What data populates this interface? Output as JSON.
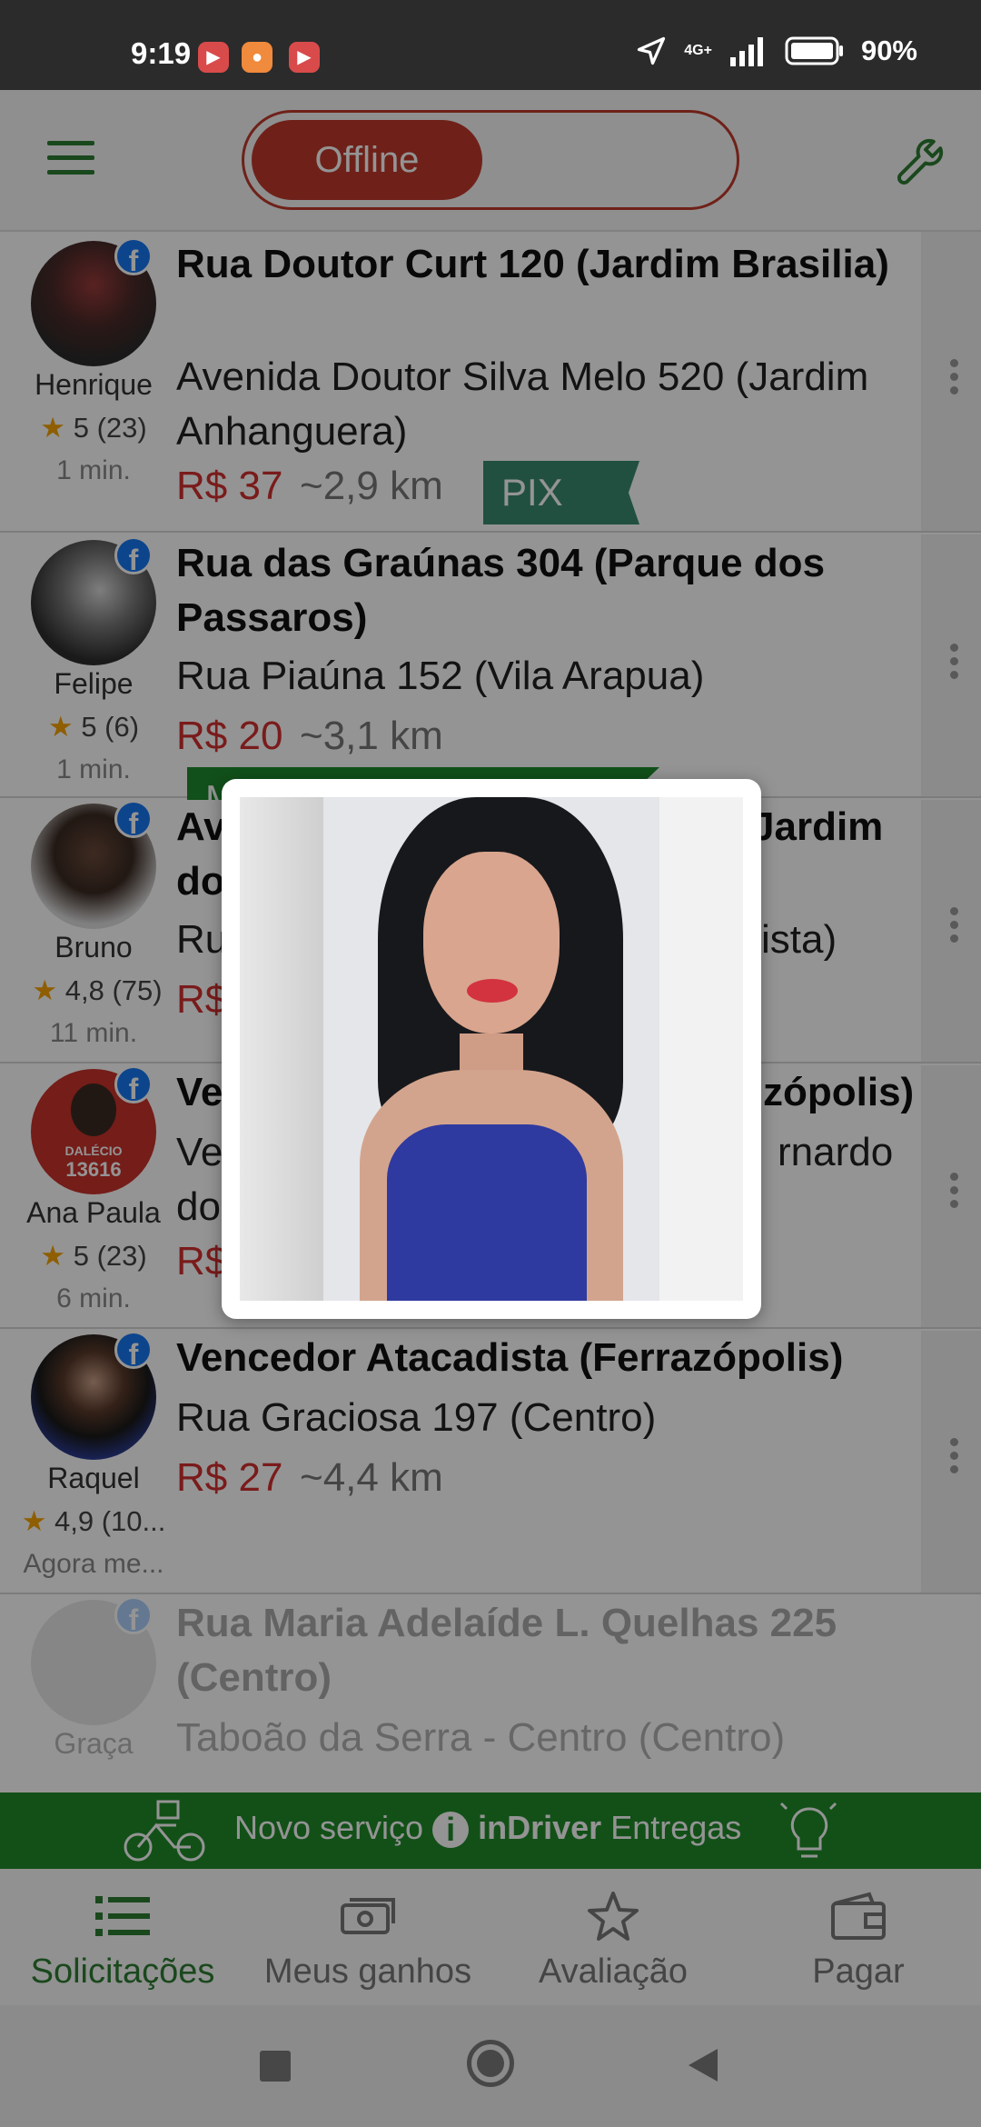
{
  "status_bar": {
    "time": "9:19",
    "network": "4G+",
    "battery": "90%"
  },
  "app_bar": {
    "status_toggle_label": "Offline"
  },
  "requests": [
    {
      "user_name": "Henrique",
      "rating": "5 (23)",
      "time_ago": "1 min.",
      "from": "Rua Doutor Curt 120 (Jardim Brasilia)",
      "to": "Avenida Doutor Silva Melo 520 (Jardim Anhanguera)",
      "price": "R$ 37",
      "distance": "~2,9 km",
      "tag": "PIX"
    },
    {
      "user_name": "Felipe",
      "rating": "5 (6)",
      "time_ago": "1 min.",
      "from": "Rua das Graúnas 304 (Parque dos Passaros)",
      "to": "Rua Piaúna 152 (Vila Arapua)",
      "price": "R$ 20",
      "distance": "~3,1 km",
      "tag": "M"
    },
    {
      "user_name": "Bruno",
      "rating": "4,8 (75)",
      "time_ago": "11 min.",
      "from_left": "Av",
      "from_right": "Jardim",
      "from_line2": "do",
      "to_left": "Ru",
      "to_right": "ista)",
      "price": "R$"
    },
    {
      "user_name": "Ana Paula",
      "avatar_badge_name": "DALÉCIO",
      "avatar_badge_number": "13616",
      "rating": "5 (23)",
      "time_ago": "6 min.",
      "from_left": "Ve",
      "from_right": "zópolis)",
      "to_left": "Ve",
      "to_right": "rnardo",
      "to_line2": "do",
      "price": "R$"
    },
    {
      "user_name": "Raquel",
      "rating": "4,9 (10...",
      "time_ago": "Agora me...",
      "from": "Vencedor Atacadista (Ferrazópolis)",
      "to": "Rua Graciosa 197 (Centro)",
      "price": "R$ 27",
      "distance": "~4,4 km"
    },
    {
      "user_name": "Graça",
      "from": "Rua Maria Adelaíde L. Quelhas 225 (Centro)",
      "to": "Taboão da Serra - Centro (Centro)"
    }
  ],
  "banner": {
    "prefix": "Novo serviço",
    "brand": "inDriver",
    "suffix": "Entregas"
  },
  "bottom_nav": {
    "items": [
      {
        "label": "Solicitações",
        "icon": "list-icon"
      },
      {
        "label": "Meus ganhos",
        "icon": "money-icon"
      },
      {
        "label": "Avaliação",
        "icon": "star-icon"
      },
      {
        "label": "Pagar",
        "icon": "wallet-icon"
      }
    ]
  },
  "colors": {
    "primary_green": "#2e7d32",
    "offline_red": "#c0392b",
    "price_red": "#d32f2f",
    "pix_teal": "#3a8a70",
    "facebook_blue": "#1877f2"
  }
}
